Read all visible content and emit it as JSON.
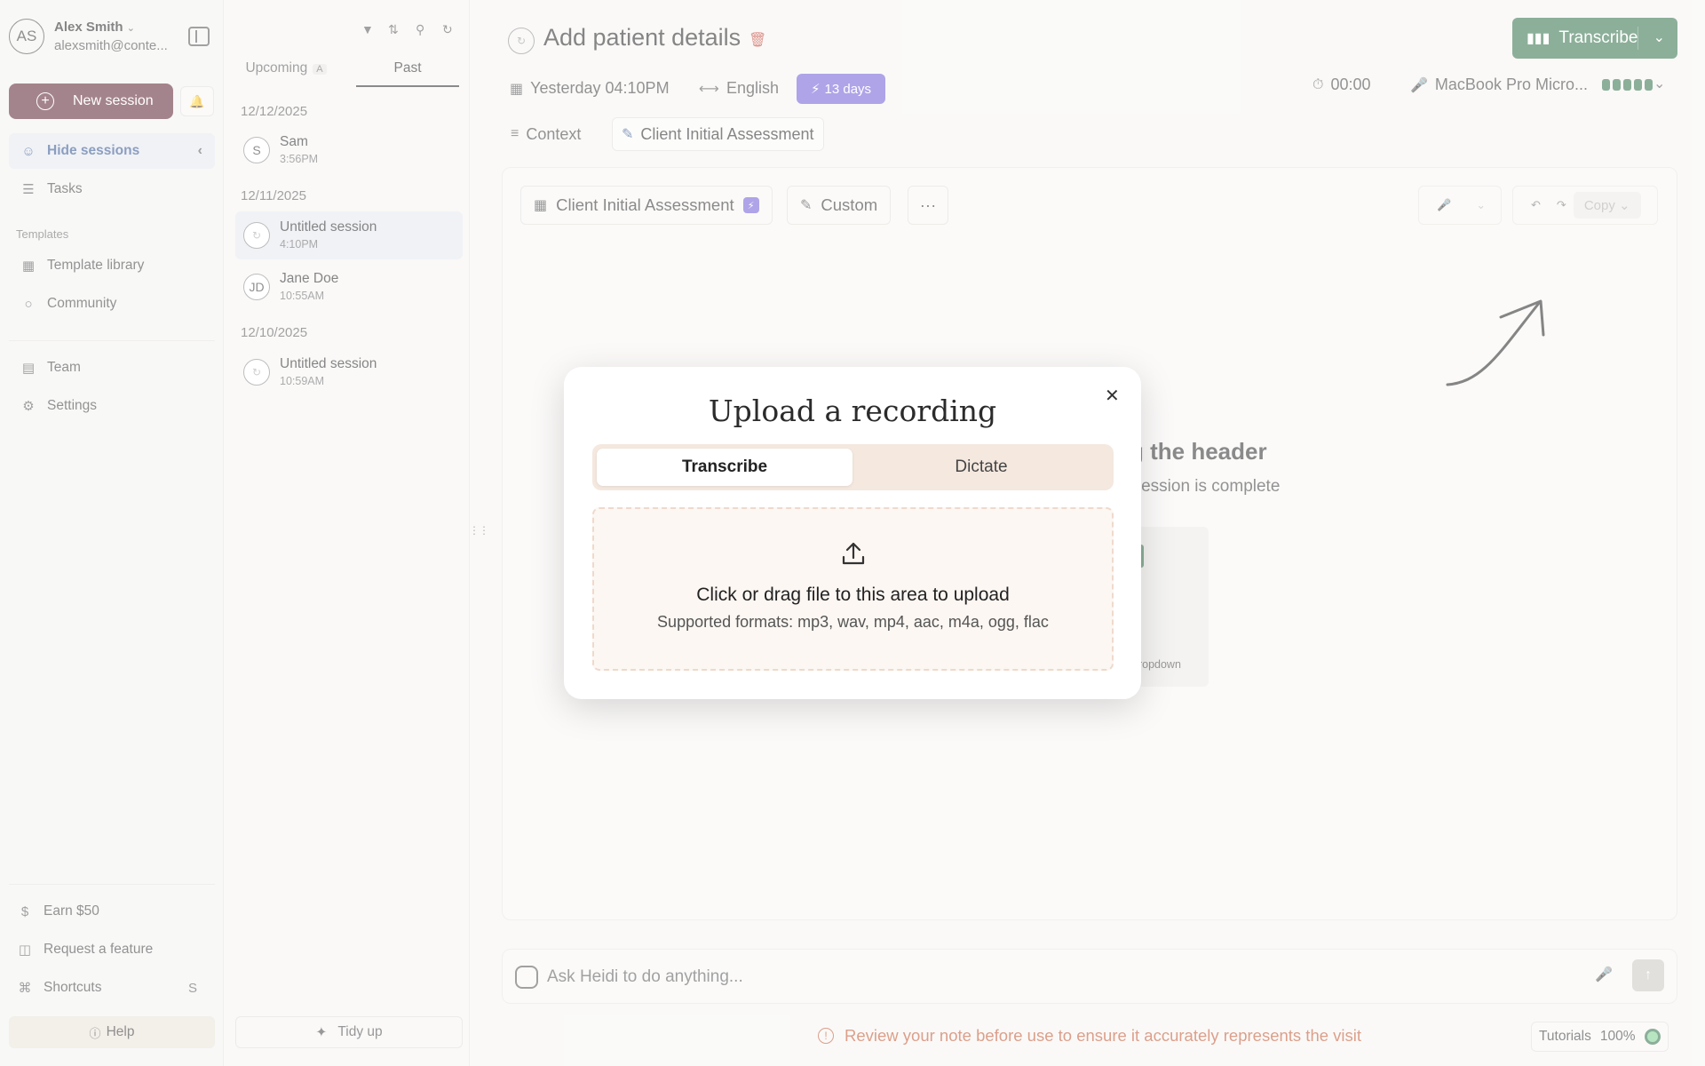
{
  "user": {
    "initials": "AS",
    "name": "Alex Smith",
    "email": "alexsmith@conte..."
  },
  "sidebar": {
    "new_session": "New session",
    "hide_sessions": "Hide sessions",
    "tasks": "Tasks",
    "templates_label": "Templates",
    "template_library": "Template library",
    "community": "Community",
    "team": "Team",
    "settings": "Settings",
    "earn": "Earn $50",
    "request_feature": "Request a feature",
    "shortcuts": "Shortcuts",
    "shortcuts_key": "S",
    "help": "Help"
  },
  "sessions": {
    "tabs": {
      "upcoming": "Upcoming",
      "upcoming_badge": "A",
      "past": "Past"
    },
    "groups": [
      {
        "date": "12/12/2025",
        "items": [
          {
            "avatar": "S",
            "name": "Sam",
            "time": "3:56PM"
          }
        ]
      },
      {
        "date": "12/11/2025",
        "items": [
          {
            "avatar": "",
            "name": "Untitled session",
            "time": "4:10PM"
          },
          {
            "avatar": "JD",
            "name": "Jane Doe",
            "time": "10:55AM"
          }
        ]
      },
      {
        "date": "12/10/2025",
        "items": [
          {
            "avatar": "",
            "name": "Untitled session",
            "time": "10:59AM"
          }
        ]
      }
    ],
    "tidy_up": "Tidy up"
  },
  "main": {
    "title": "Add patient details",
    "transcribe": "Transcribe",
    "date": "Yesterday 04:10PM",
    "language": "English",
    "days_badge": "13 days",
    "timer": "00:00",
    "microphone": "MacBook Pro Micro...",
    "tabs": {
      "context": "Context",
      "assessment": "Client Initial Assessment"
    },
    "toolbar": {
      "template": "Client Initial Assessment",
      "custom": "Custom",
      "more": "···",
      "copy": "Copy"
    },
    "bg_heading": "g the header",
    "bg_sub": "r session is complete",
    "bg_card_text": "dropdown",
    "ask_placeholder": "Ask Heidi to do anything...",
    "warning": "Review your note before use to ensure it accurately represents the visit",
    "tutorials": "Tutorials",
    "zoom": "100%"
  },
  "modal": {
    "title": "Upload a recording",
    "tabs": {
      "transcribe": "Transcribe",
      "dictate": "Dictate"
    },
    "drop_main": "Click or drag file to this area to upload",
    "drop_sub": "Supported formats: mp3, wav, mp4, aac, m4a, ogg, flac"
  },
  "colors": {
    "brand_maroon": "#5a1f2e",
    "accent_green": "#2e6e46",
    "badge_purple": "#6e5ad6",
    "warning": "#c0502a"
  }
}
